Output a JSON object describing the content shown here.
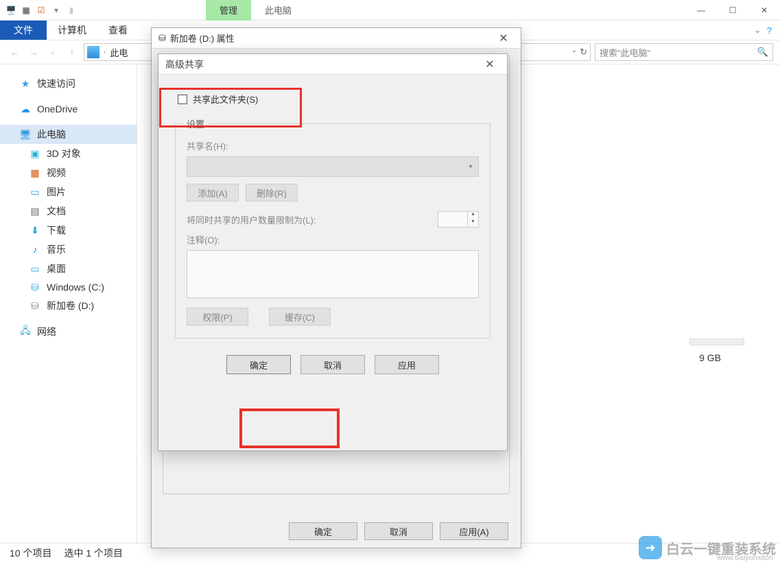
{
  "ribbon": {
    "manage": "管理",
    "this_pc": "此电脑"
  },
  "menu": {
    "file": "文件",
    "computer": "计算机",
    "view": "查看"
  },
  "address": {
    "location": "此电",
    "refresh_glyph": "↻"
  },
  "search": {
    "placeholder": "搜索\"此电脑\""
  },
  "sidebar": {
    "quick_access": "快速访问",
    "onedrive": "OneDrive",
    "this_pc": "此电脑",
    "objects_3d": "3D 对象",
    "videos": "视频",
    "pictures": "图片",
    "documents": "文档",
    "downloads": "下载",
    "music": "音乐",
    "desktop": "桌面",
    "drive_c": "Windows (C:)",
    "drive_d": "新加卷 (D:)",
    "network": "网络"
  },
  "content": {
    "drive_size": "9 GB"
  },
  "status": {
    "items": "10 个项目",
    "selected": "选中 1 个项目"
  },
  "props_dialog": {
    "title": "新加卷 (D:) 属性",
    "ok": "确定",
    "cancel": "取消",
    "apply": "应用(A)"
  },
  "adv_dialog": {
    "title": "高级共享",
    "share_checkbox": "共享此文件夹(S)",
    "settings_legend": "设置",
    "share_name_label": "共享名(H):",
    "add_btn": "添加(A)",
    "remove_btn": "删除(R)",
    "limit_label": "将同时共享的用户数量限制为(L):",
    "comment_label": "注释(O):",
    "perm_btn": "权限(P)",
    "cache_btn": "缓存(C)",
    "ok": "确定",
    "cancel": "取消",
    "apply": "应用"
  },
  "watermark": {
    "text": "白云一键重装系统",
    "url": "www.baiyunxiton"
  }
}
